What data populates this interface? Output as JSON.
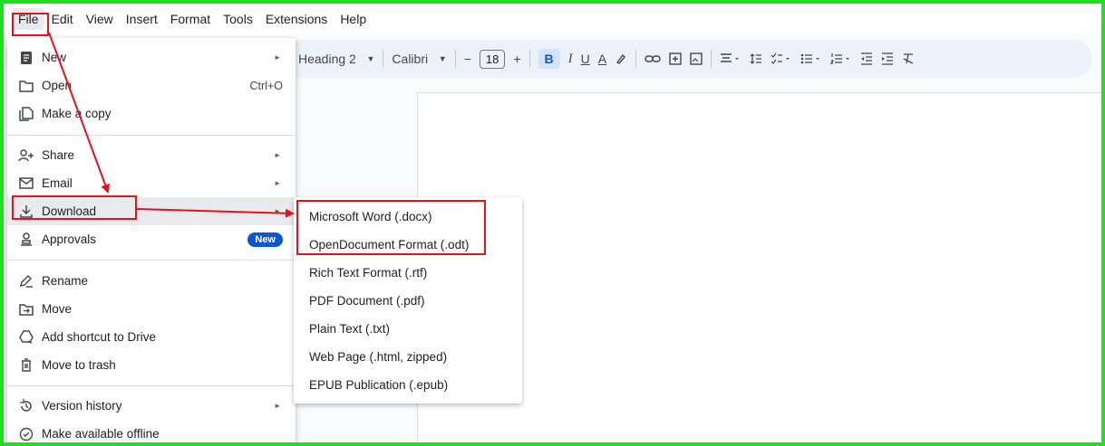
{
  "menubar": {
    "items": [
      "File",
      "Edit",
      "View",
      "Insert",
      "Format",
      "Tools",
      "Extensions",
      "Help"
    ]
  },
  "toolbar": {
    "style_select": "Heading 2",
    "font_select": "Calibri",
    "font_size": "18",
    "minus": "−",
    "plus": "+",
    "bold": "B",
    "italic": "I",
    "underline": "U",
    "text_color": "A"
  },
  "file_menu": {
    "items": [
      {
        "label": "New",
        "icon": "document-icon"
      },
      {
        "label": "Open",
        "icon": "folder-icon",
        "shortcut": "Ctrl+O"
      },
      {
        "label": "Make a copy",
        "icon": "copy-icon"
      },
      {
        "label": "Share",
        "icon": "person-add-icon"
      },
      {
        "label": "Email",
        "icon": "mail-icon"
      },
      {
        "label": "Download",
        "icon": "download-icon"
      },
      {
        "label": "Approvals",
        "icon": "approvals-icon",
        "badge": "New"
      },
      {
        "label": "Rename",
        "icon": "pencil-icon"
      },
      {
        "label": "Move",
        "icon": "move-folder-icon"
      },
      {
        "label": "Add shortcut to Drive",
        "icon": "drive-shortcut-icon"
      },
      {
        "label": "Move to trash",
        "icon": "trash-icon"
      },
      {
        "label": "Version history",
        "icon": "history-icon"
      },
      {
        "label": "Make available offline",
        "icon": "offline-icon"
      }
    ]
  },
  "download_submenu": {
    "items": [
      "Microsoft Word (.docx)",
      "OpenDocument Format (.odt)",
      "Rich Text Format (.rtf)",
      "PDF Document (.pdf)",
      "Plain Text (.txt)",
      "Web Page (.html, zipped)",
      "EPUB Publication (.epub)"
    ]
  },
  "colors": {
    "frame": "#1fe01f",
    "annotation": "#e0141e",
    "accent": "#0b57d0"
  }
}
